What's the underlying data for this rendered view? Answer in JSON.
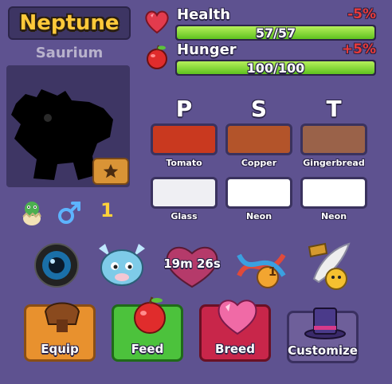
{
  "pet": {
    "name": "Neptune",
    "species": "Saurium",
    "gender_icon": "male-symbol-icon",
    "level": "1"
  },
  "stats": {
    "health": {
      "label": "Health",
      "value": "57/57",
      "delta": "-5%",
      "fill": 1.0
    },
    "hunger": {
      "label": "Hunger",
      "value": "100/100",
      "delta": "+5%",
      "fill": 1.0
    }
  },
  "traits": {
    "letters": [
      "P",
      "S",
      "T"
    ],
    "primary_colors": [
      {
        "name": "Tomato",
        "color": "#c9391f"
      },
      {
        "name": "Copper",
        "color": "#b3542a"
      },
      {
        "name": "Gingerbread",
        "color": "#9a6249"
      }
    ],
    "secondary_colors": [
      {
        "name": "Glass",
        "color": "#efeff3"
      },
      {
        "name": "Neon",
        "color": "#ffffff"
      },
      {
        "name": "Neon",
        "color": "#ffffff"
      }
    ]
  },
  "badges": {
    "timer": "19m 26s",
    "dna_count": "1"
  },
  "actions": {
    "equip": "Equip",
    "feed": "Feed",
    "breed": "Breed",
    "customize": "Customize"
  },
  "colors": {
    "background": "#5e5290",
    "name_gold": "#ffc93a",
    "bar_green": "#7fd63a",
    "delta_red": "#e83a3a"
  }
}
